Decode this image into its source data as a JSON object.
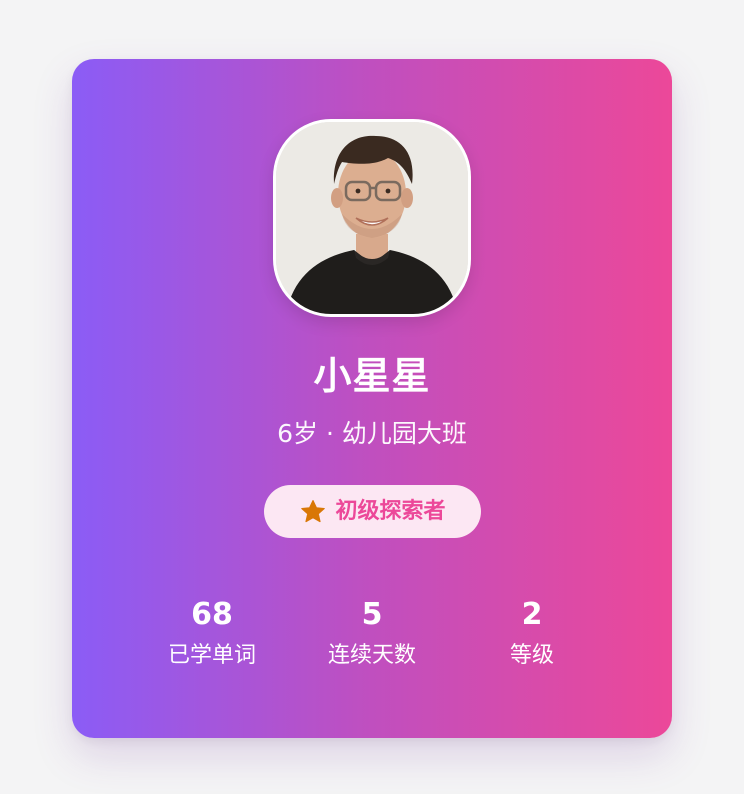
{
  "profile": {
    "name": "小星星",
    "subtitle": "6岁 · 幼儿园大班",
    "badge": {
      "label": "初级探索者",
      "icon": "star-icon",
      "icon_color": "#d97706",
      "text_color": "#ec4899",
      "background": "#fce7f3"
    }
  },
  "stats": [
    {
      "value": "68",
      "label": "已学单词"
    },
    {
      "value": "5",
      "label": "连续天数"
    },
    {
      "value": "2",
      "label": "等级"
    }
  ],
  "colors": {
    "gradient_start": "#8b5cf6",
    "gradient_end": "#ec4899",
    "page_background": "#f4f4f5"
  }
}
